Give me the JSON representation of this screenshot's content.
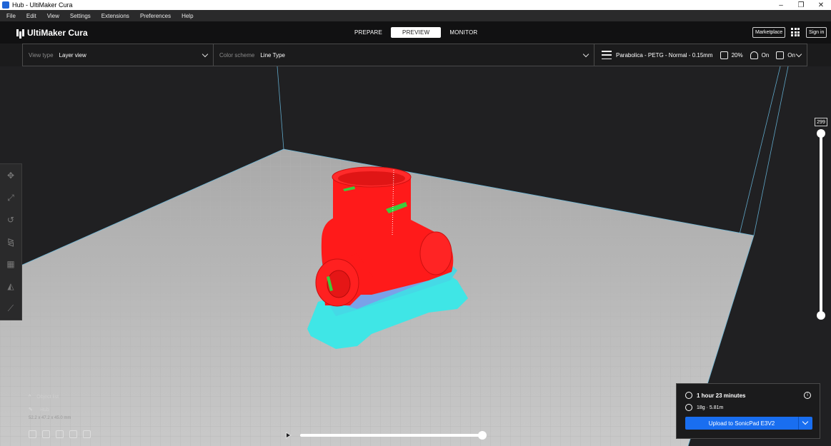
{
  "window": {
    "title": "Hub - UltiMaker Cura",
    "minimize": "–",
    "restore": "❐",
    "close": "✕"
  },
  "menu": [
    "File",
    "Edit",
    "View",
    "Settings",
    "Extensions",
    "Preferences",
    "Help"
  ],
  "header": {
    "logo": "UltiMaker Cura",
    "tabs": [
      {
        "label": "PREPARE",
        "active": false
      },
      {
        "label": "PREVIEW",
        "active": true
      },
      {
        "label": "MONITOR",
        "active": false
      }
    ],
    "marketplace": "Marketplace",
    "sign_in": "Sign in"
  },
  "toolbar": {
    "view_type_label": "View type",
    "view_type_value": "Layer view",
    "color_scheme_label": "Color scheme",
    "color_scheme_value": "Line Type",
    "profile": "Parabolica - PETG - Normal - 0.15mm",
    "infill": "20%",
    "support": "On",
    "adhesion": "On"
  },
  "tools": [
    "move-icon",
    "scale-icon",
    "rotate-icon",
    "mirror-icon",
    "per-model-settings-icon",
    "support-blocker-icon",
    "measure-icon"
  ],
  "layer_slider": {
    "max_layer": "299"
  },
  "object_list": {
    "header": "Object list",
    "object_name": "Hub",
    "dimensions": "52.2 x 47.2 x 45.0 mm"
  },
  "print_info": {
    "time": "1 hour 23 minutes",
    "material": "18g · 5.81m",
    "upload_label": "Upload to SonicPad E3V2"
  },
  "colors": {
    "accent": "#196ef0",
    "model": "#ff1a1a",
    "support": "#38e8e8",
    "bed": "#c8c8c8"
  }
}
